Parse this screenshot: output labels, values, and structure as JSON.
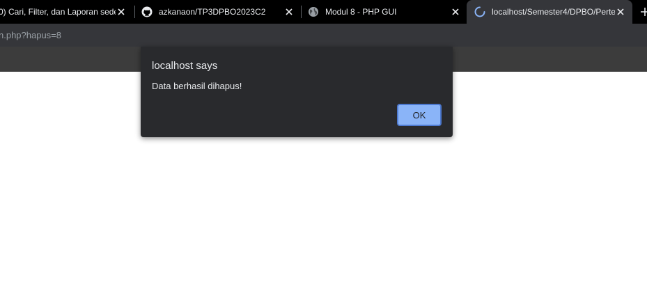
{
  "browser": {
    "tabs": [
      {
        "title": "0) Cari, Filter, dan Laporan sede",
        "icon": "page-icon",
        "active": false
      },
      {
        "title": "azkanaon/TP3DPBO2023C2",
        "icon": "github-icon",
        "active": false
      },
      {
        "title": "Modul 8 - PHP GUI",
        "icon": "globe-icon",
        "active": false
      },
      {
        "title": "localhost/Semester4/DPBO/Perte",
        "icon": "loading-spinner-icon",
        "active": true
      }
    ],
    "address_bar": {
      "url_visible": "n.php?hapus=8"
    }
  },
  "dialog": {
    "title": "localhost says",
    "message": "Data berhasil dihapus!",
    "ok_label": "OK"
  },
  "colors": {
    "tabstrip": "#000000",
    "toolbar": "#35363a",
    "dialog_bg": "#292a2d",
    "ok_button": "#8ab4f8",
    "spinner": "#8ab4f8"
  }
}
